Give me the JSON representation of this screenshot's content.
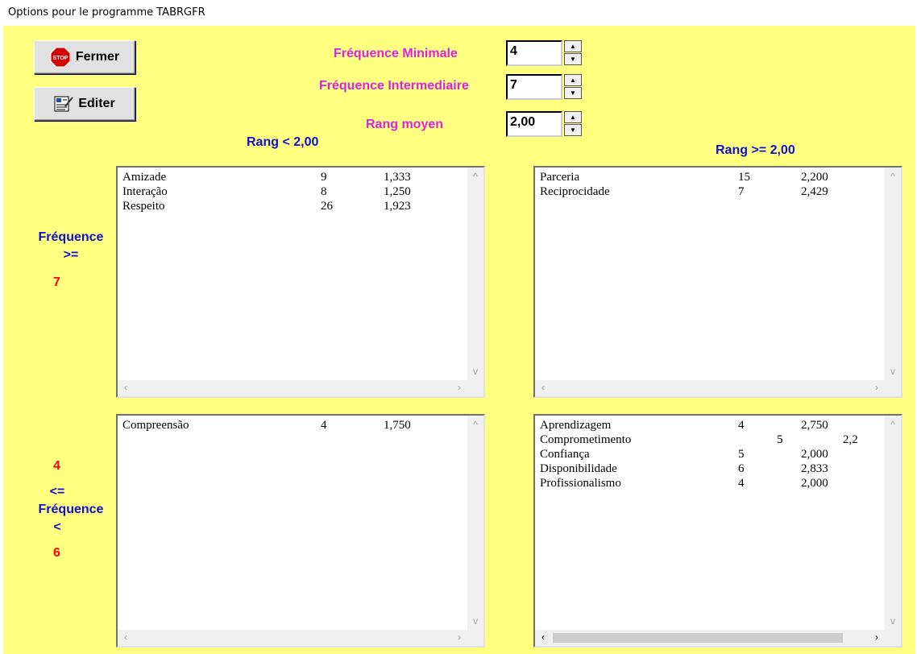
{
  "window": {
    "title": "Options pour le programme TABRGFR"
  },
  "buttons": {
    "fermer": "Fermer",
    "stop_text": "STOP",
    "editer": "Editer"
  },
  "settings": {
    "freq_min_label": "Fréquence Minimale",
    "freq_min_value": "4",
    "freq_int_label": "Fréquence Intermediaire",
    "freq_int_value": "7",
    "rang_label": "Rang moyen",
    "rang_value": "2,00"
  },
  "headers": {
    "rang_low": "Rang < 2,00",
    "rang_high": "Rang >= 2,00"
  },
  "row_labels": {
    "upper_freq": "Fréquence",
    "upper_op": ">=",
    "upper_val": "7",
    "lower_min": "4",
    "lower_op1": "<=",
    "lower_freq": "Fréquence",
    "lower_op2": "<",
    "lower_val": "6"
  },
  "lists": {
    "top_left": [
      {
        "word": "Amizade",
        "freq": "9",
        "rank": "1,333"
      },
      {
        "word": "Interação",
        "freq": "8",
        "rank": "1,250"
      },
      {
        "word": "Respeito",
        "freq": "26",
        "rank": "1,923"
      }
    ],
    "top_right": [
      {
        "word": "Parceria",
        "freq": "15",
        "rank": "2,200"
      },
      {
        "word": "Reciprocidade",
        "freq": "7",
        "rank": "2,429"
      }
    ],
    "bottom_left": [
      {
        "word": "Compreensão",
        "freq": "4",
        "rank": "1,750"
      }
    ],
    "bottom_right": [
      {
        "word": "Aprendizagem",
        "freq": "4",
        "rank": "2,750"
      },
      {
        "word": "Comprometimento",
        "freq": "5",
        "rank": "2,2"
      },
      {
        "word": "Confiança",
        "freq": "5",
        "rank": "2,000"
      },
      {
        "word": "Disponibilidade",
        "freq": "6",
        "rank": "2,833"
      },
      {
        "word": "Profissionalismo",
        "freq": "4",
        "rank": "2,000"
      }
    ]
  },
  "icons": {
    "stop": "stop-sign-icon",
    "edit": "edit-document-icon",
    "up": "▲",
    "down": "▼",
    "left": "‹",
    "right": "›",
    "sup": "^",
    "sdown": "v"
  }
}
